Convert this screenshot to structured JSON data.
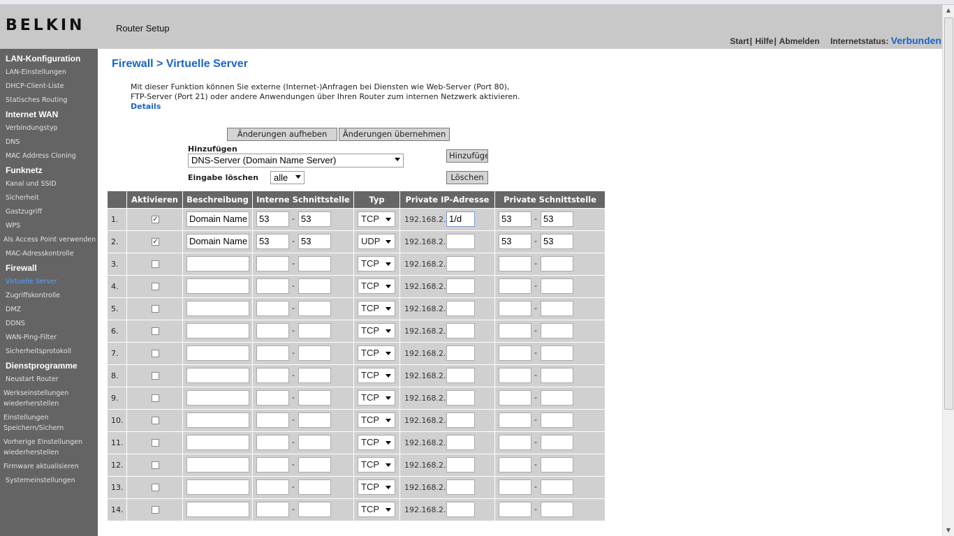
{
  "header": {
    "logo": "BELKIN",
    "app_title": "Router Setup",
    "links": [
      "Start",
      "Hilfe",
      "Abmelden"
    ],
    "status_label": "Internetstatus:",
    "status_value": "Verbunden"
  },
  "sidebar": {
    "sections": [
      {
        "title": "LAN-Konfiguration",
        "items": [
          "LAN-Einstellungen",
          "DHCP-Client-Liste",
          "Statisches Routing"
        ]
      },
      {
        "title": "Internet WAN",
        "items": [
          "Verbindungstyp",
          "DNS",
          "MAC Address Cloning"
        ]
      },
      {
        "title": "Funknetz",
        "items": [
          "Kanal und SSID",
          "Sicherheit",
          "Gastzugriff",
          "WPS",
          "Als Access Point verwenden",
          "MAC-Adresskontrolle"
        ]
      },
      {
        "title": "Firewall",
        "items": [
          "Virtuelle Server",
          "Zugriffskontrolle",
          "DMZ",
          "DDNS",
          "WAN-Ping-Filter",
          "Sicherheitsprotokoll"
        ]
      },
      {
        "title": "Dienstprogramme",
        "items": [
          "Neustart Router",
          "Werkseinstellungen wiederherstellen",
          "Einstellungen Speichern/Sichern",
          "Vorherige Einstellungen wiederherstellen",
          "Firmware aktualisieren",
          "Systemeinstellungen"
        ]
      }
    ],
    "active_item": "Virtuelle Server"
  },
  "main": {
    "title": "Firewall > Virtuelle Server",
    "description": "Mit dieser Funktion können Sie externe (Internet-)Anfragen bei Diensten wie Web-Server (Port 80), FTP-Server (Port 21) oder andere Anwendungen über Ihren Router zum internen Netzwerk aktivieren.",
    "details_link": "Details",
    "btn_revert": "Änderungen aufheben",
    "btn_apply": "Änderungen übernehmen",
    "add_label": "Hinzufügen",
    "add_select_value": "DNS-Server (Domain Name Server)",
    "add_button": "Hinzufügen",
    "clear_label": "Eingabe löschen",
    "clear_select_value": "alle",
    "clear_button": "Löschen"
  },
  "table": {
    "headers": [
      "",
      "Aktivieren",
      "Beschreibung",
      "Interne Schnittstelle",
      "Typ",
      "Private IP-Adresse",
      "Private Schnittstelle"
    ],
    "ip_prefix": "192.168.2.",
    "rows": [
      {
        "num": "1.",
        "checked": true,
        "desc": "Domain Name",
        "in_from": "53",
        "in_to": "53",
        "type": "TCP",
        "ip": "1/d",
        "priv_from": "53",
        "priv_to": "53"
      },
      {
        "num": "2.",
        "checked": true,
        "desc": "Domain Name",
        "in_from": "53",
        "in_to": "53",
        "type": "UDP",
        "ip": "",
        "priv_from": "53",
        "priv_to": "53"
      },
      {
        "num": "3.",
        "checked": false,
        "desc": "",
        "in_from": "",
        "in_to": "",
        "type": "TCP",
        "ip": "",
        "priv_from": "",
        "priv_to": ""
      },
      {
        "num": "4.",
        "checked": false,
        "desc": "",
        "in_from": "",
        "in_to": "",
        "type": "TCP",
        "ip": "",
        "priv_from": "",
        "priv_to": ""
      },
      {
        "num": "5.",
        "checked": false,
        "desc": "",
        "in_from": "",
        "in_to": "",
        "type": "TCP",
        "ip": "",
        "priv_from": "",
        "priv_to": ""
      },
      {
        "num": "6.",
        "checked": false,
        "desc": "",
        "in_from": "",
        "in_to": "",
        "type": "TCP",
        "ip": "",
        "priv_from": "",
        "priv_to": ""
      },
      {
        "num": "7.",
        "checked": false,
        "desc": "",
        "in_from": "",
        "in_to": "",
        "type": "TCP",
        "ip": "",
        "priv_from": "",
        "priv_to": ""
      },
      {
        "num": "8.",
        "checked": false,
        "desc": "",
        "in_from": "",
        "in_to": "",
        "type": "TCP",
        "ip": "",
        "priv_from": "",
        "priv_to": ""
      },
      {
        "num": "9.",
        "checked": false,
        "desc": "",
        "in_from": "",
        "in_to": "",
        "type": "TCP",
        "ip": "",
        "priv_from": "",
        "priv_to": ""
      },
      {
        "num": "10.",
        "checked": false,
        "desc": "",
        "in_from": "",
        "in_to": "",
        "type": "TCP",
        "ip": "",
        "priv_from": "",
        "priv_to": ""
      },
      {
        "num": "11.",
        "checked": false,
        "desc": "",
        "in_from": "",
        "in_to": "",
        "type": "TCP",
        "ip": "",
        "priv_from": "",
        "priv_to": ""
      },
      {
        "num": "12.",
        "checked": false,
        "desc": "",
        "in_from": "",
        "in_to": "",
        "type": "TCP",
        "ip": "",
        "priv_from": "",
        "priv_to": ""
      },
      {
        "num": "13.",
        "checked": false,
        "desc": "",
        "in_from": "",
        "in_to": "",
        "type": "TCP",
        "ip": "",
        "priv_from": "",
        "priv_to": ""
      },
      {
        "num": "14.",
        "checked": false,
        "desc": "",
        "in_from": "",
        "in_to": "",
        "type": "TCP",
        "ip": "",
        "priv_from": "",
        "priv_to": ""
      }
    ]
  },
  "colors": {
    "accent": "#1a64c8",
    "sidebar_bg": "#646464",
    "header_bg": "#c8c8c8",
    "table_header": "#666666",
    "row_bg": "#d0d0d0"
  },
  "icons": {
    "checkbox_checked": "check-icon",
    "dropdown": "chevron-down-icon"
  }
}
